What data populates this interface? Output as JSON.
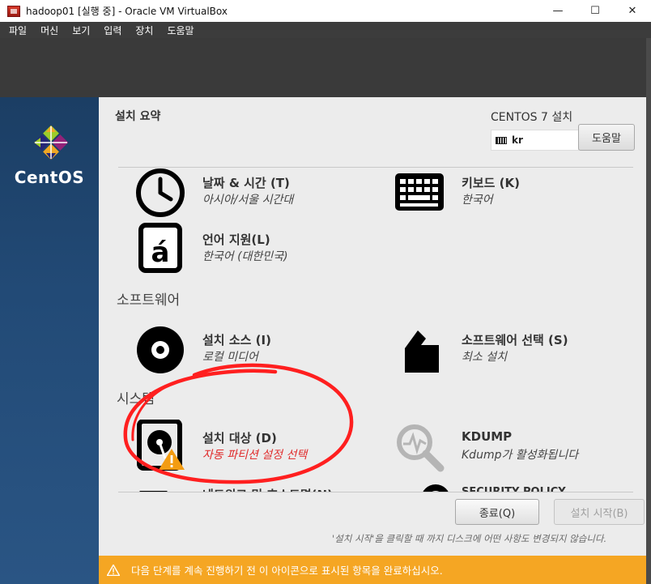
{
  "window": {
    "title": "hadoop01 [실행 중] - Oracle VM VirtualBox",
    "controls": {
      "minimize": "—",
      "maximize": "☐",
      "close": "✕"
    }
  },
  "menu": [
    "파일",
    "머신",
    "보기",
    "입력",
    "장치",
    "도움말"
  ],
  "sidebar": {
    "logo_text": "CentOS"
  },
  "header": {
    "title": "설치 요약",
    "product": "CENTOS 7 설치",
    "keyboard_layout": "kr",
    "help_label": "도움말"
  },
  "sections": {
    "software": "소프트웨어",
    "system": "시스템"
  },
  "spokes": {
    "datetime": {
      "name": "날짜 & 시간 (T)",
      "status": "아시아/서울 시간대",
      "icon": "clock-icon"
    },
    "keyboard": {
      "name": "키보드 (K)",
      "status": "한국어",
      "icon": "keyboard-icon"
    },
    "language": {
      "name": "언어 지원(L)",
      "status": "한국어 (대한민국)",
      "icon": "language-icon"
    },
    "source": {
      "name": "설치 소스 (I)",
      "status": "로컬 미디어",
      "icon": "disc-icon"
    },
    "software_selection": {
      "name": "소프트웨어 선택 (S)",
      "status": "최소 설치",
      "icon": "package-icon"
    },
    "destination": {
      "name": "설치 대상 (D)",
      "status": "자동 파티션 설정 선택",
      "icon": "harddisk-icon"
    },
    "kdump": {
      "name": "KDUMP",
      "status": "Kdump가 활성화됩니다",
      "icon": "magnifier-icon"
    },
    "network": {
      "name": "네트워크 및 호스트명(N)",
      "icon": "network-icon"
    },
    "security": {
      "name": "SECURITY POLICY",
      "icon": "lock-icon"
    }
  },
  "footer": {
    "quit_label": "종료(Q)",
    "begin_label": "설치 시작(B)",
    "hint": "'설치 시작'을 클릭할 때 까지 디스크에 어떤 사항도 변경되지 않습니다.",
    "warning": "다음 단계를 계속 진행하기 전 이 아이콘으로 표시된 항목을 완료하십시오."
  },
  "colors": {
    "sidebar": "#224a76",
    "main_bg": "#ececec",
    "warning_bar": "#f5a623",
    "warning_text": "#e02b2b",
    "annotation": "#ff1f1f"
  }
}
